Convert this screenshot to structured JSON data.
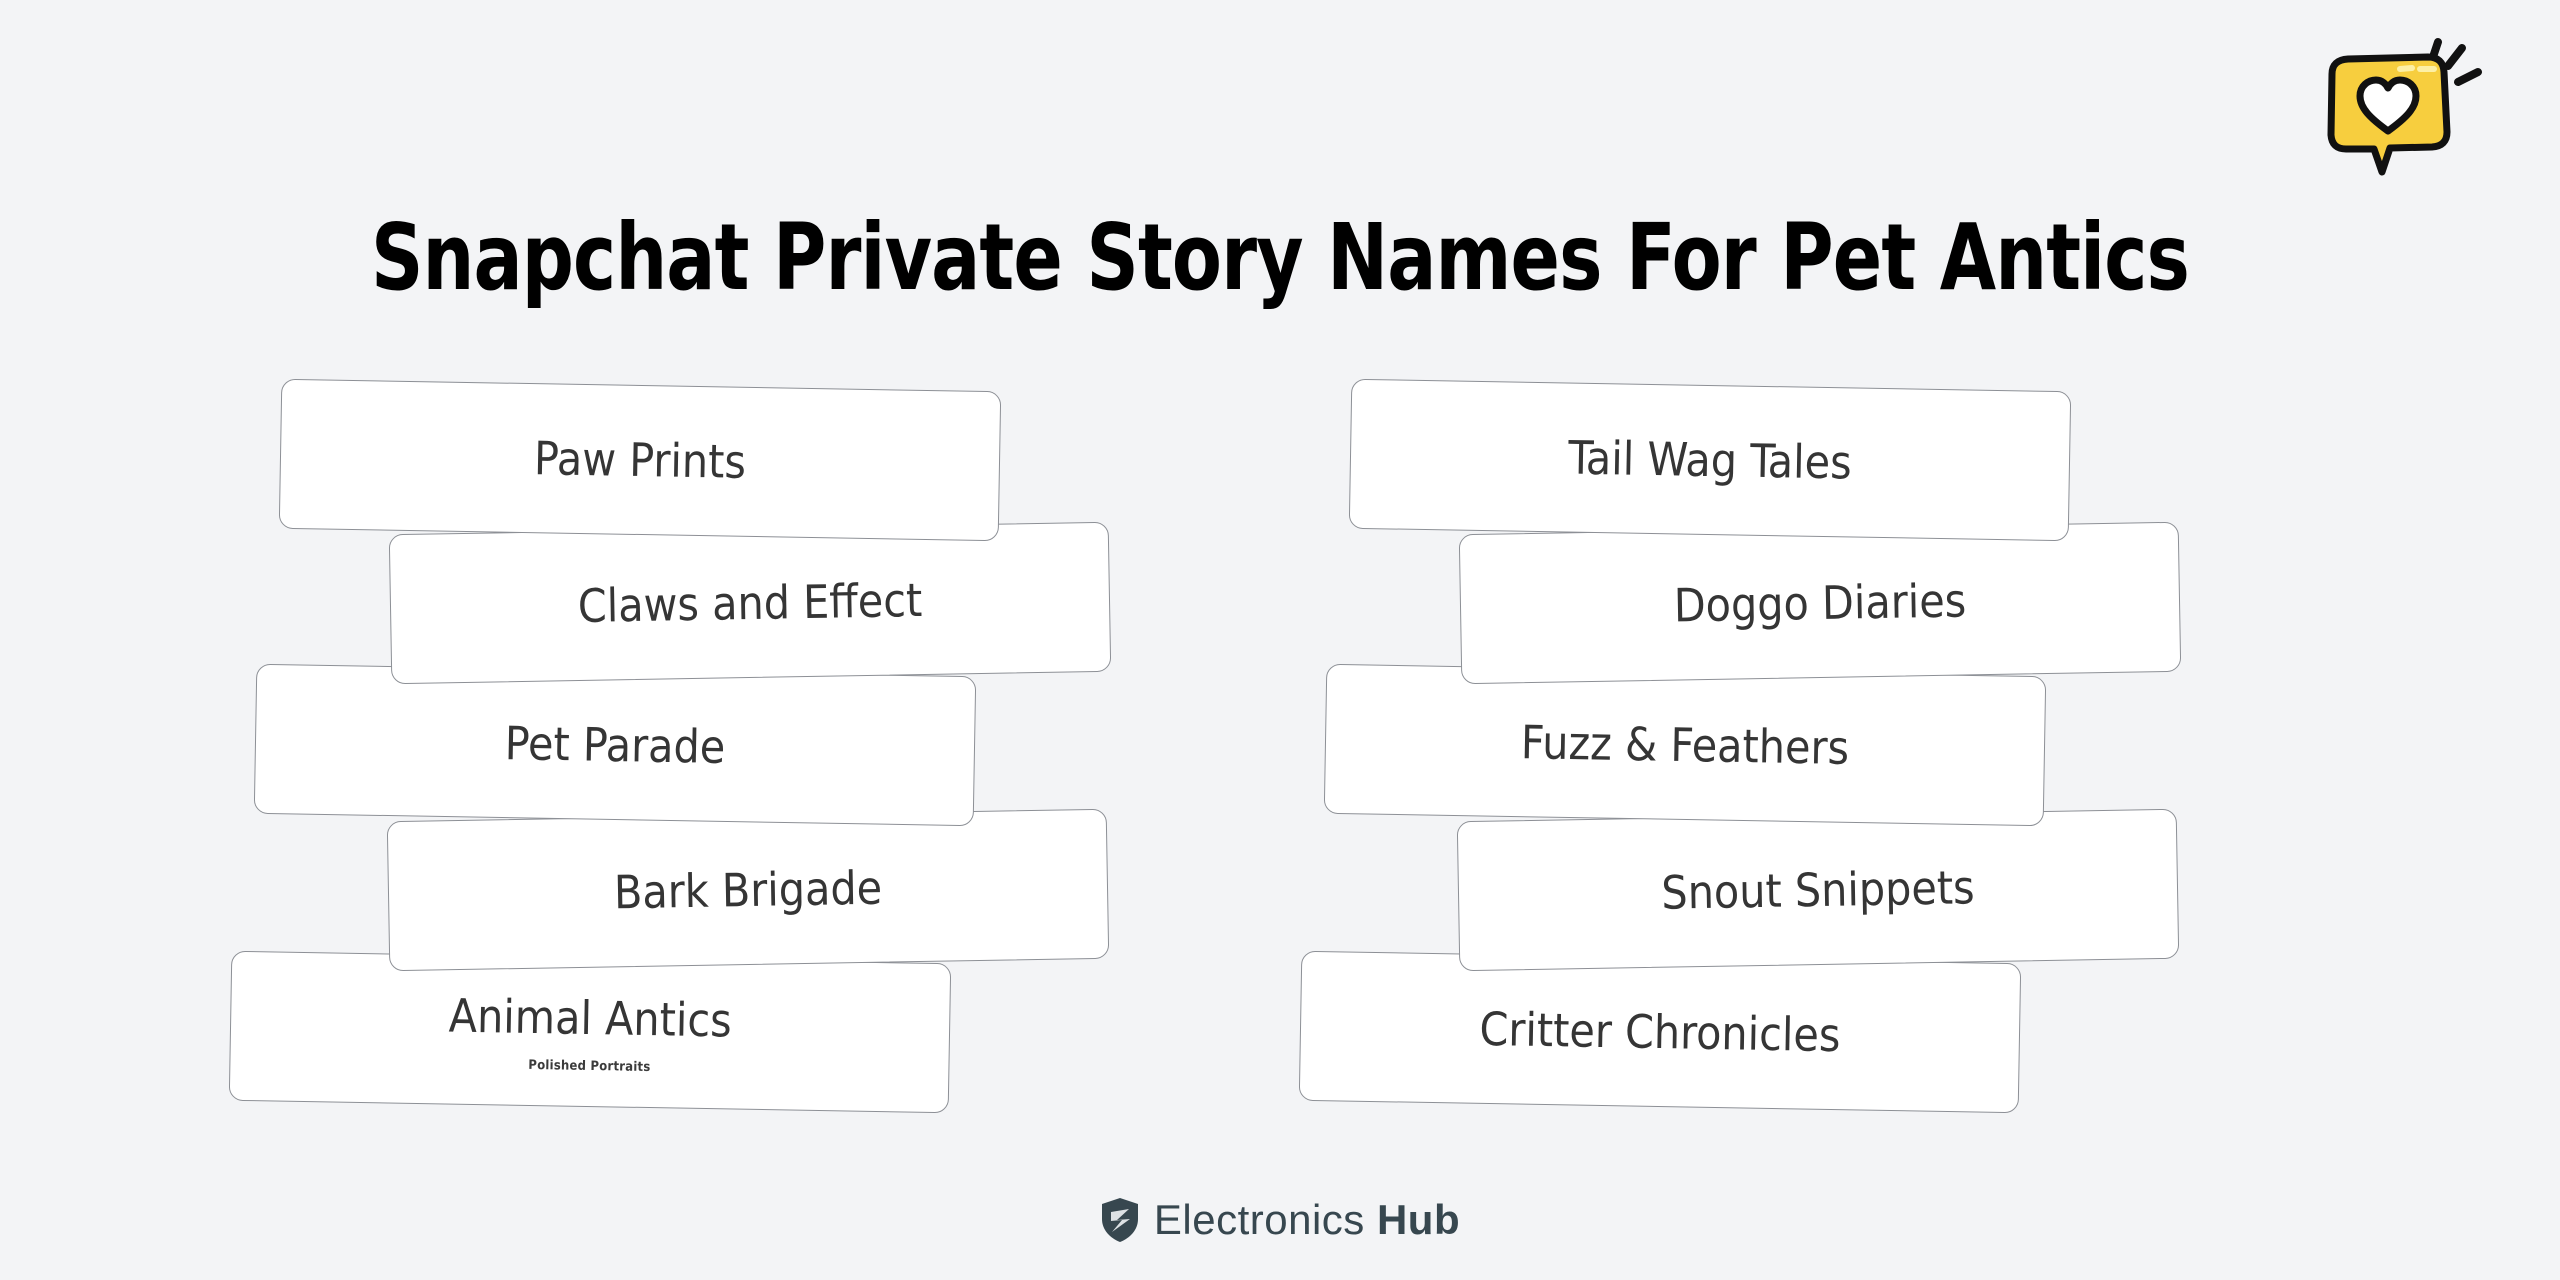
{
  "page": {
    "background_color": "#f3f4f6",
    "title": "Snapchat Private Story Names For Pet Antics"
  },
  "sticker": {
    "name": "speech-bubble-heart-sticker",
    "bubble_color": "#f7ce3e",
    "heart_color": "#ffffff",
    "outline_color": "#111111"
  },
  "columns": [
    {
      "id": "left",
      "cards": [
        {
          "label": "Paw Prints",
          "sub": ""
        },
        {
          "label": "Claws and Effect",
          "sub": ""
        },
        {
          "label": "Pet Parade",
          "sub": ""
        },
        {
          "label": "Bark Brigade",
          "sub": ""
        },
        {
          "label": "Animal Antics",
          "sub": "Polished Portraits"
        }
      ]
    },
    {
      "id": "right",
      "cards": [
        {
          "label": "Tail Wag Tales",
          "sub": ""
        },
        {
          "label": "Doggo Diaries",
          "sub": ""
        },
        {
          "label": "Fuzz & Feathers",
          "sub": ""
        },
        {
          "label": "Snout Snippets",
          "sub": ""
        },
        {
          "label": "Critter Chronicles",
          "sub": ""
        }
      ]
    }
  ],
  "footer": {
    "brand_light": "Electronics",
    "brand_bold": "Hub",
    "shield_color": "#37474f"
  }
}
